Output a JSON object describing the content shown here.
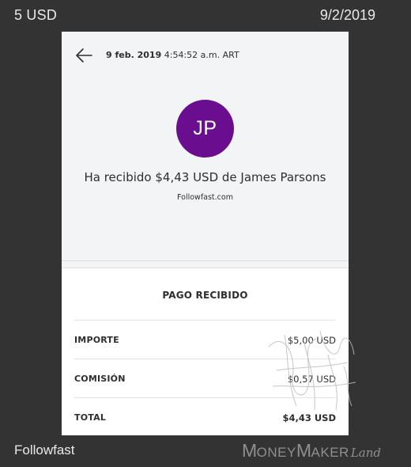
{
  "overlay": {
    "amount_label": "5 USD",
    "date_label": "9/2/2019",
    "service_label": "Followfast",
    "watermark": {
      "part1_initial": "M",
      "part1_rest": "ONEY",
      "part2_initial": "M",
      "part2_rest": "AKER",
      "part3": "Land"
    }
  },
  "transaction": {
    "date": "9 feb. 2019",
    "time": "4:54:52 a.m. ART",
    "avatar_initials": "JP",
    "avatar_color": "#6a0d8e",
    "title": "Ha recibido $4,43 USD de James Parsons",
    "sender_site": "Followfast.com"
  },
  "details": {
    "section_title": "PAGO RECIBIDO",
    "rows": [
      {
        "label": "IMPORTE",
        "value": "$5,00 USD"
      },
      {
        "label": "COMISIÓN",
        "value": "$0,57 USD"
      },
      {
        "label": "TOTAL",
        "value": "$4,43 USD"
      }
    ]
  },
  "icons": {
    "back": "arrow-left-icon"
  }
}
